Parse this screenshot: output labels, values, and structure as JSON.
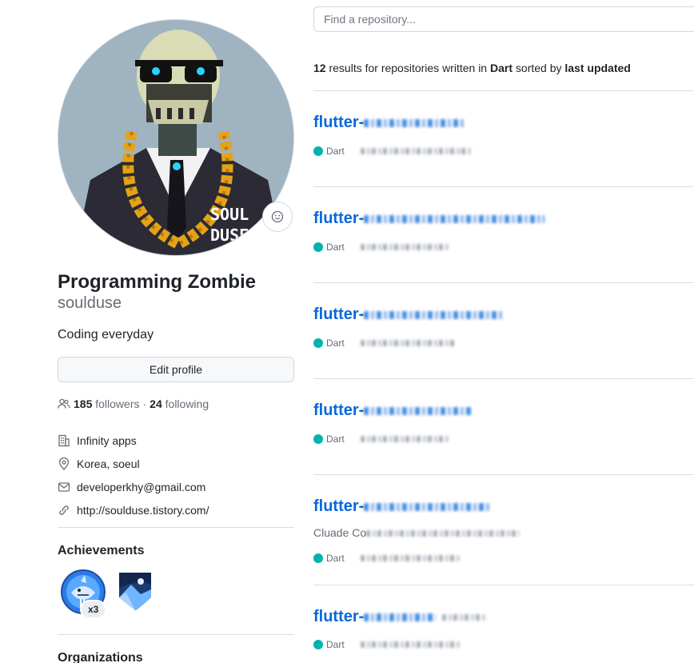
{
  "profile": {
    "name": "Programming Zombie",
    "login": "soulduse",
    "bio": "Coding everyday",
    "edit_label": "Edit profile",
    "followers_count": "185",
    "followers_label": "followers",
    "separator": "·",
    "following_count": "24",
    "following_label": "following",
    "avatar_text_line1": "SOUL",
    "avatar_text_line2": "DUSE",
    "vcard": {
      "company": "Infinity apps",
      "location": "Korea, soeul",
      "email": "developerkhy@gmail.com",
      "website": "http://soulduse.tistory.com/"
    },
    "icons": {
      "followers": "people-icon",
      "company": "organization-icon",
      "location": "location-pin-icon",
      "email": "mail-icon",
      "website": "link-icon",
      "status": "smiley-icon"
    },
    "achievements_title": "Achievements",
    "achievement_count": "x3",
    "organizations_title": "Organizations"
  },
  "repositories": {
    "search_placeholder": "Find a repository...",
    "results_count": "12",
    "results_text_1": "results for repositories written in",
    "results_language": "Dart",
    "results_text_2": "sorted by",
    "results_sort": "last updated",
    "items": [
      {
        "name": "flutter-",
        "language": "Dart"
      },
      {
        "name": "flutter-",
        "language": "Dart"
      },
      {
        "name": "flutter-",
        "language": "Dart"
      },
      {
        "name": "flutter-",
        "language": "Dart"
      },
      {
        "name": "flutter-",
        "language": "Dart",
        "description": "Cluade Co"
      },
      {
        "name": "flutter-",
        "language": "Dart"
      }
    ]
  },
  "colors": {
    "link": "#0969da",
    "dart": "#00b4ab",
    "muted": "#656d76",
    "border": "#d0d7de"
  }
}
